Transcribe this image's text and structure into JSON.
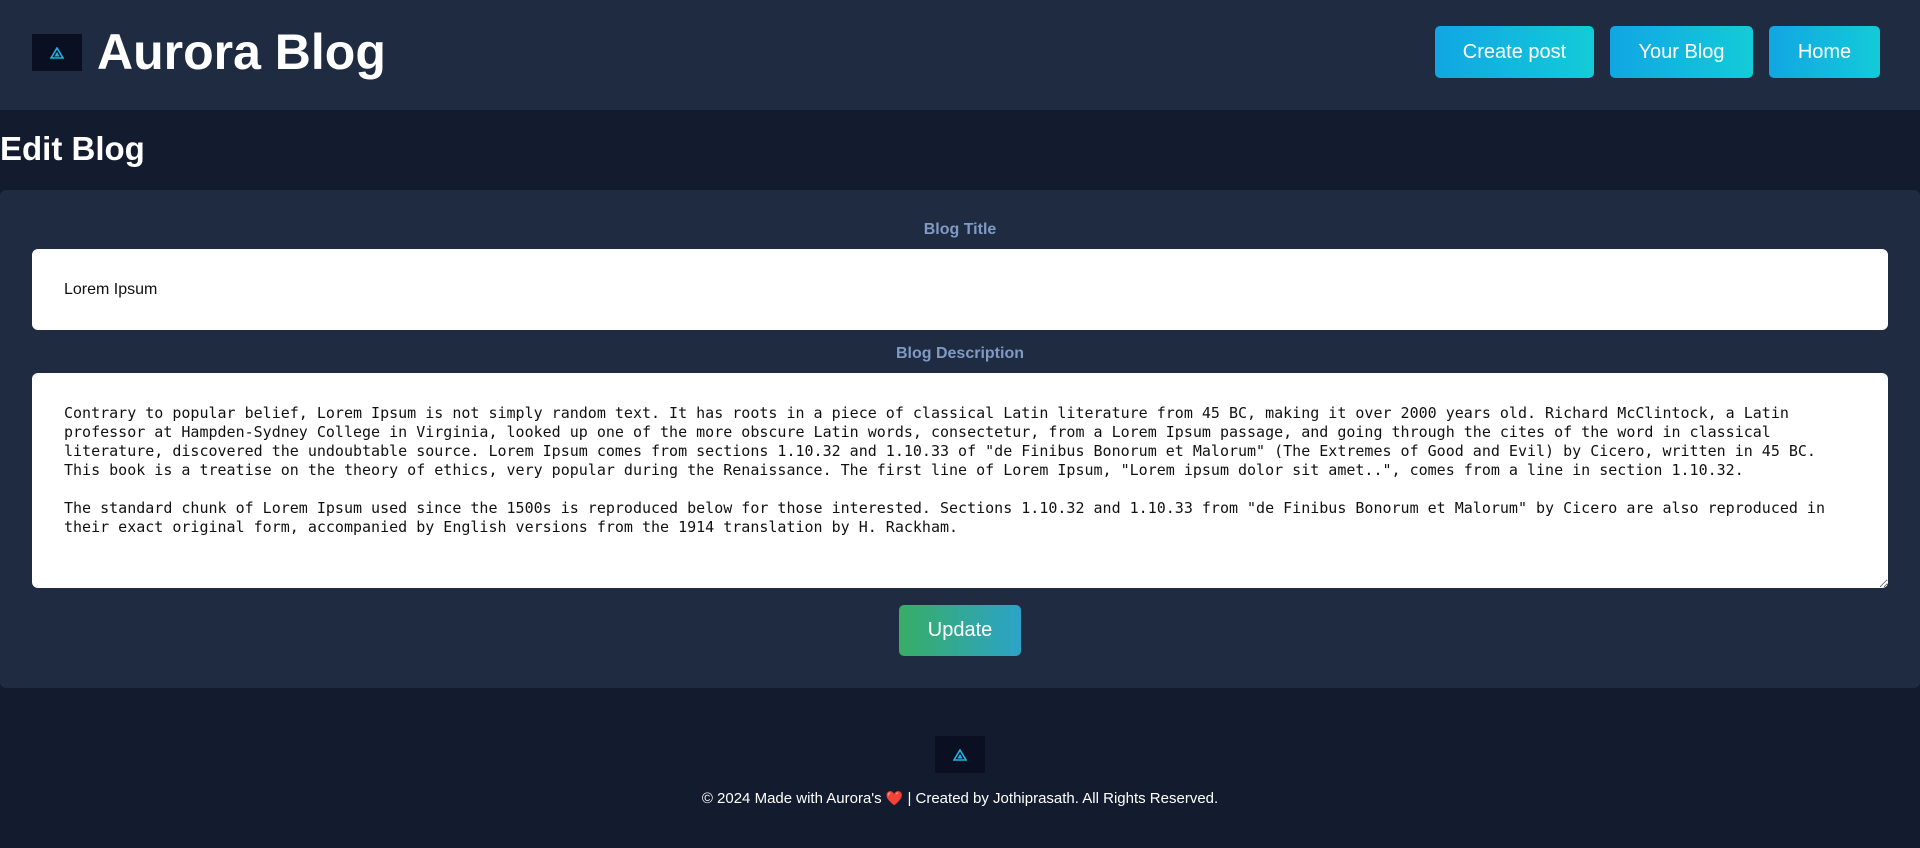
{
  "header": {
    "brand": "Aurora Blog",
    "logo_icon": "aurora-logo-icon",
    "nav": {
      "create_post": "Create post",
      "your_blog": "Your Blog",
      "home": "Home"
    }
  },
  "page": {
    "title": "Edit Blog"
  },
  "form": {
    "title_label": "Blog Title",
    "title_value": "Lorem Ipsum",
    "description_label": "Blog Description",
    "description_value": "Contrary to popular belief, Lorem Ipsum is not simply random text. It has roots in a piece of classical Latin literature from 45 BC, making it over 2000 years old. Richard McClintock, a Latin professor at Hampden-Sydney College in Virginia, looked up one of the more obscure Latin words, consectetur, from a Lorem Ipsum passage, and going through the cites of the word in classical literature, discovered the undoubtable source. Lorem Ipsum comes from sections 1.10.32 and 1.10.33 of \"de Finibus Bonorum et Malorum\" (The Extremes of Good and Evil) by Cicero, written in 45 BC. This book is a treatise on the theory of ethics, very popular during the Renaissance. The first line of Lorem Ipsum, \"Lorem ipsum dolor sit amet..\", comes from a line in section 1.10.32.\n\nThe standard chunk of Lorem Ipsum used since the 1500s is reproduced below for those interested. Sections 1.10.32 and 1.10.33 from \"de Finibus Bonorum et Malorum\" by Cicero are also reproduced in their exact original form, accompanied by English versions from the 1914 translation by H. Rackham.",
    "update_label": "Update"
  },
  "footer": {
    "text_before": "© 2024 Made with Aurora's",
    "heart": "❤️",
    "text_after": "| Created by Jothiprasath. All Rights Reserved."
  },
  "colors": {
    "background": "#131b2e",
    "panel": "#1f2b40",
    "nav_button_gradient_start": "#11a6e3",
    "nav_button_gradient_end": "#13cbd8",
    "update_gradient_start": "#38ad66",
    "update_gradient_end": "#2ca3c8",
    "label": "#7f9ac4",
    "logo_accent": "#1fb4e6"
  }
}
